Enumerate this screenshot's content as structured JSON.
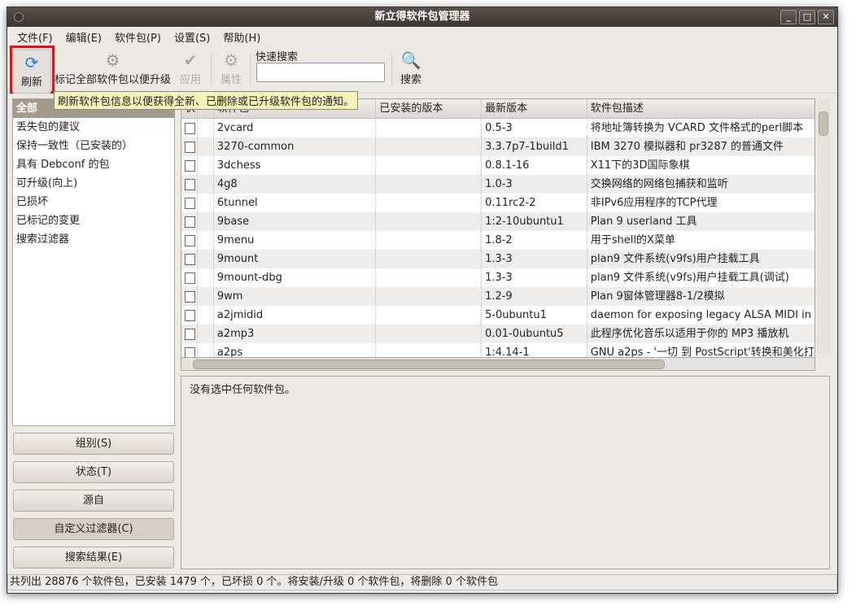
{
  "window": {
    "title": "新立得软件包管理器",
    "controls": [
      "_",
      "□",
      "✕"
    ]
  },
  "menu": [
    "文件(F)",
    "编辑(E)",
    "软件包(P)",
    "设置(S)",
    "帮助(H)"
  ],
  "toolbar": {
    "refresh": "刷新",
    "mark_all": "标记全部软件包以便升级",
    "apply": "应用",
    "properties": "属性",
    "quick_search_label": "快速搜索",
    "quick_search_value": "",
    "search": "搜索",
    "tooltip": "刷新软件包信息以便获得全新、已删除或已升级软件包的通知。"
  },
  "filters": [
    "全部",
    "丢失包的建议",
    "保持一致性（已安装的）",
    "具有 Debconf 的包",
    "可升级(向上)",
    "已损坏",
    "已标记的变更",
    "搜索过滤器"
  ],
  "filter_buttons": [
    "组别(S)",
    "状态(T)",
    "源自",
    "自定义过滤器(C)",
    "搜索结果(E)"
  ],
  "table": {
    "headers": [
      "状",
      "",
      "软件包",
      "已安装的版本",
      "最新版本",
      "软件包描述"
    ],
    "rows": [
      [
        "2vcard",
        "",
        "0.5-3",
        "将地址簿转换为 VCARD 文件格式的perl脚本"
      ],
      [
        "3270-common",
        "",
        "3.3.7p7-1build1",
        "IBM 3270 模拟器和 pr3287 的普通文件"
      ],
      [
        "3dchess",
        "",
        "0.8.1-16",
        "X11下的3D国际象棋"
      ],
      [
        "4g8",
        "",
        "1.0-3",
        "交换网络的网络包捕获和监听"
      ],
      [
        "6tunnel",
        "",
        "0.11rc2-2",
        "非IPv6应用程序的TCP代理"
      ],
      [
        "9base",
        "",
        "1:2-10ubuntu1",
        "Plan 9 userland 工具"
      ],
      [
        "9menu",
        "",
        "1.8-2",
        "用于shell的X菜单"
      ],
      [
        "9mount",
        "",
        "1.3-3",
        "plan9 文件系统(v9fs)用户挂载工具"
      ],
      [
        "9mount-dbg",
        "",
        "1.3-3",
        "plan9 文件系统(v9fs)用户挂载工具(调试)"
      ],
      [
        "9wm",
        "",
        "1.2-9",
        "Plan 9窗体管理器8-1/2模拟"
      ],
      [
        "a2jmidid",
        "",
        "5-0ubuntu1",
        "daemon for exposing legacy ALSA MIDI in"
      ],
      [
        "a2mp3",
        "",
        "0.01-0ubuntu5",
        "此程序优化音乐以适用于你的 MP3 播放机"
      ],
      [
        "a2ps",
        "",
        "1:4.14-1",
        "GNU a2ps - '一切 到 PostScript'转换和美化打"
      ]
    ]
  },
  "details": "没有选中任何软件包。",
  "status": "共列出 28876 个软件包，已安装 1479 个，已坏损 0 个。将安装/升级 0 个软件包，将删除 0 个软件包"
}
